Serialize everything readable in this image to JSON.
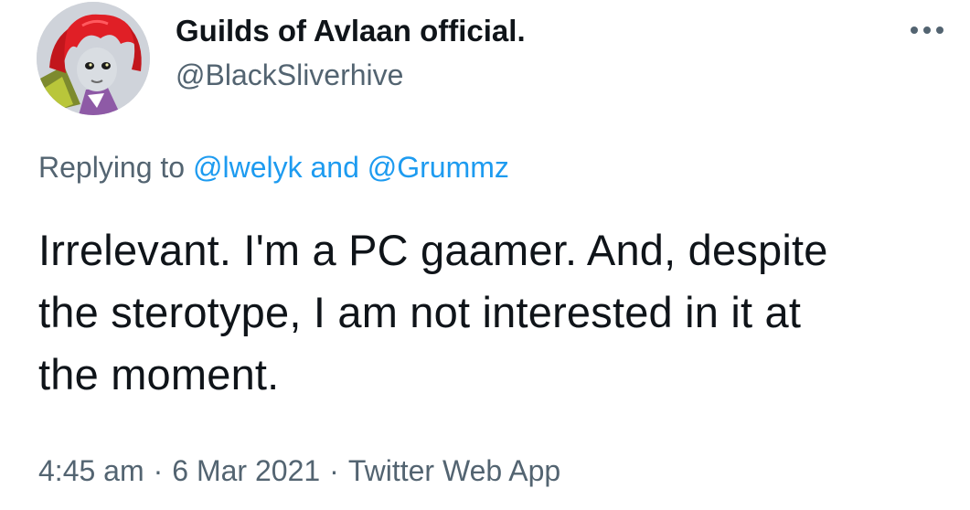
{
  "author": {
    "display_name": "Guilds of Avlaan official.",
    "handle": "@BlackSliverhive",
    "avatar_icon": "avatar-image"
  },
  "more_icon": "more-horizontal-icon",
  "reply": {
    "prefix": "Replying to",
    "mentions": [
      "@lwelyk",
      "@Grummz"
    ],
    "joiner": "and"
  },
  "tweet": {
    "lines": [
      "Irrelevant. I'm a PC gaamer. And, despite",
      "the sterotype, I am not interested in it at",
      "the moment."
    ]
  },
  "meta": {
    "time": "4:45 am",
    "date": "6 Mar 2021",
    "source": "Twitter Web App",
    "separator": "·"
  },
  "colors": {
    "text": "#0f1419",
    "secondary": "#536471",
    "link": "#1d9bf0",
    "background": "#ffffff"
  }
}
